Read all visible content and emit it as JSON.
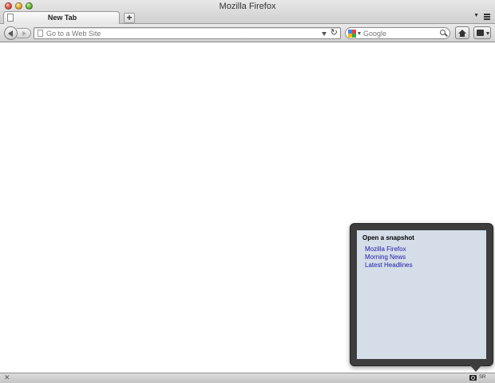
{
  "window": {
    "title": "Mozilla Firefox"
  },
  "tabs": [
    {
      "label": "New Tab"
    }
  ],
  "tabstrip": {
    "new_tab_label": "+"
  },
  "navbar": {
    "url_placeholder": "Go to a Web Site",
    "reload_glyph": "↻",
    "search_placeholder": "Google"
  },
  "snapshot_panel": {
    "title": "Open a snapshot",
    "items": [
      "Mozilla Firefox",
      "Morning News",
      "Latest Headlines"
    ]
  },
  "statusbar": {
    "close_glyph": "✕",
    "addon_label": "SR"
  },
  "colors": {
    "link": "#1a1aa8",
    "panel_bg": "#3d3d3d",
    "panel_inner": "#d5dee8",
    "google_blue": "#4285f4",
    "google_red": "#ea4335",
    "google_yellow": "#fbbc05",
    "google_green": "#34a853"
  }
}
